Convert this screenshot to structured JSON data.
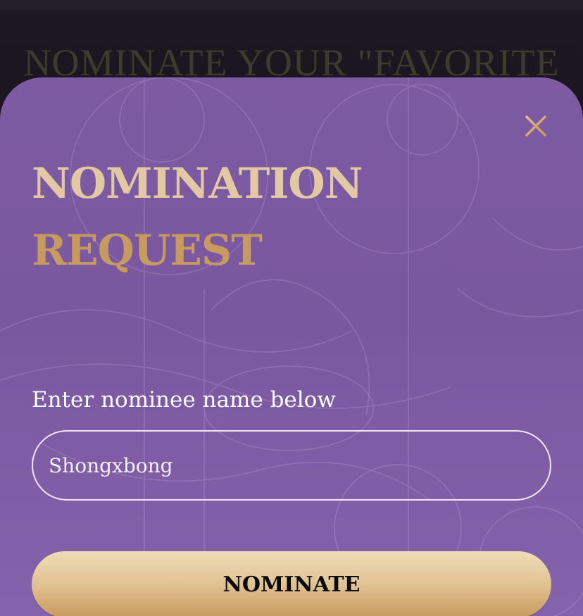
{
  "background": {
    "heading": "NOMINATE YOUR \"FAVORITE"
  },
  "modal": {
    "title_line1": "NOMINATION",
    "title_line2": "REQUEST",
    "close_icon": "close-icon",
    "field_label": "Enter nominee name below",
    "input_value": "Shongxbong",
    "submit_label": "NOMINATE"
  },
  "colors": {
    "modal_background": "#7d5aa2",
    "title_light_gold": "#e3c9a3",
    "title_dark_gold": "#c79a5f",
    "button_gold_top": "#efdcb7",
    "button_gold_bottom": "#c89b5f",
    "close_icon": "#d9a97a"
  }
}
